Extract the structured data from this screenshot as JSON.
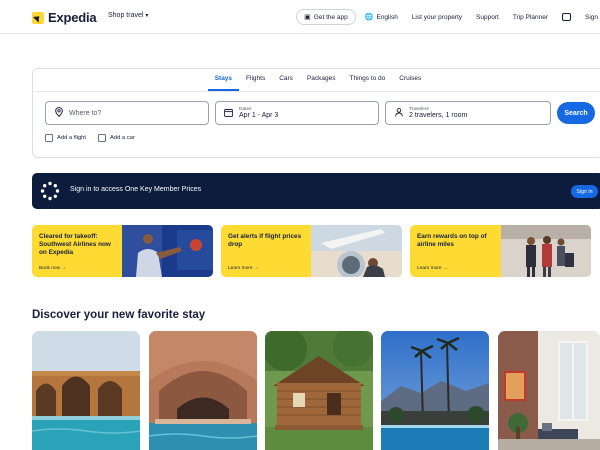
{
  "header": {
    "brand": "Expedia",
    "shop_travel": "Shop travel",
    "get_app": "Get the app",
    "language": "English",
    "list_property": "List your property",
    "support": "Support",
    "trip_planner": "Trip Planner",
    "sign_in": "Sign"
  },
  "search": {
    "tabs": [
      "Stays",
      "Flights",
      "Cars",
      "Packages",
      "Things to do",
      "Cruises"
    ],
    "active_tab": "Stays",
    "where_placeholder": "Where to?",
    "dates_label": "Dates",
    "dates_value": "Apr 1 - Apr 3",
    "travelers_label": "Travelers",
    "travelers_value": "2 travelers, 1 room",
    "search_button": "Search",
    "add_flight": "Add a flight",
    "add_car": "Add a car"
  },
  "banner": {
    "text": "Sign in to access One Key Member Prices",
    "button": "Sign in"
  },
  "promos": [
    {
      "title": "Cleared for takeoff: Southwest Airlines now on Expedia",
      "link": "Book now"
    },
    {
      "title": "Get alerts if flight prices drop",
      "link": "Learn more"
    },
    {
      "title": "Earn rewards on top of airline miles",
      "link": "Learn more"
    }
  ],
  "discover": {
    "title": "Discover your new favorite stay"
  },
  "colors": {
    "accent": "#1668e3",
    "brand_yellow": "#fddb32",
    "navy": "#0d1b3d"
  },
  "icons": {
    "where": "location-pin-icon",
    "dates": "calendar-icon",
    "travelers": "person-icon",
    "language": "globe-icon",
    "get_app": "phone-icon",
    "messages": "chat-icon"
  }
}
